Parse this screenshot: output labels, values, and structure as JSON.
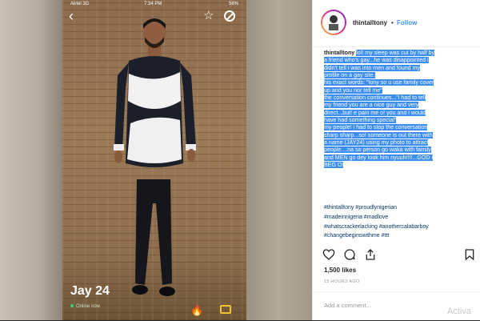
{
  "phone": {
    "status_carrier": "Airtel  3G",
    "status_time": "7:34 PM",
    "status_battery": "56%",
    "profile_name": "Jay  24",
    "online_status": "Online now",
    "icons": [
      "back-icon",
      "star-icon",
      "block-icon",
      "tap-icon",
      "chat-icon"
    ],
    "accent_color": "#f2c230"
  },
  "instagram": {
    "username": "thintalltony",
    "follow_label": "Follow",
    "dot": "•",
    "caption_user": "thintalltony",
    "caption_lines": [
      "lol! my sleep was cut by half by",
      "a friend who's gay...he was disappointed i",
      "didn't tell i was into men and found my",
      "profile on a gay site.",
      "his exact words: \"tony so u use family cover",
      "up and you nor tell me\"",
      "the conversation continues...\"i had to tell",
      "my friend you are a nice guy and very",
      "direct...but! e pain me o! you and i would",
      "have had something special\"",
      "my people! i had to stop the conversation",
      "sharp sharp...so! someone is out there with",
      "a name (JAY24) using my photo to attract",
      "people....na so person go waka with family",
      "and MEN go dey look him nyuuh!!!!...GOD I",
      "BEG O!"
    ],
    "hashtag_lines": [
      "#thintalltony #proudlynigerian",
      "#madeinnigeria #madlove",
      "#whatscrackerlacking #anothercalabarboy",
      "#changebeginswithme #ttt"
    ],
    "likes": "1,500 likes",
    "time_ago": "15 HOURS AGO",
    "add_comment_placeholder": "Add a comment...",
    "watermark": "Activa",
    "link_color": "#3897f0",
    "highlight_color": "#3c8ef0",
    "icons": [
      "heart-icon",
      "comment-icon",
      "share-icon",
      "bookmark-icon"
    ]
  }
}
